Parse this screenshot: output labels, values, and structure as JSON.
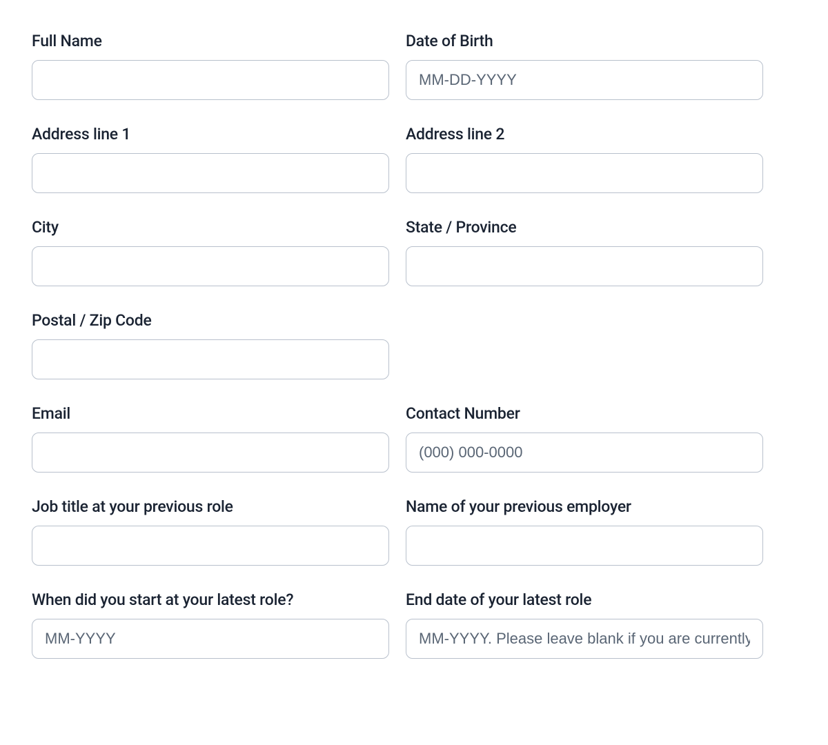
{
  "fields": {
    "full_name": {
      "label": "Full Name",
      "placeholder": "",
      "value": ""
    },
    "dob": {
      "label": "Date of Birth",
      "placeholder": "MM-DD-YYYY",
      "value": ""
    },
    "address1": {
      "label": "Address line 1",
      "placeholder": "",
      "value": ""
    },
    "address2": {
      "label": "Address line 2",
      "placeholder": "",
      "value": ""
    },
    "city": {
      "label": "City",
      "placeholder": "",
      "value": ""
    },
    "state": {
      "label": "State / Province",
      "placeholder": "",
      "value": ""
    },
    "postal": {
      "label": "Postal / Zip Code",
      "placeholder": "",
      "value": ""
    },
    "email": {
      "label": "Email",
      "placeholder": "",
      "value": ""
    },
    "contact": {
      "label": "Contact Number",
      "placeholder": "(000) 000-0000",
      "value": ""
    },
    "job_title": {
      "label": "Job title at your previous role",
      "placeholder": "",
      "value": ""
    },
    "employer": {
      "label": "Name of your previous employer",
      "placeholder": "",
      "value": ""
    },
    "start_date": {
      "label": "When did you start at your latest role?",
      "placeholder": "MM-YYYY",
      "value": ""
    },
    "end_date": {
      "label": "End date of your latest role",
      "placeholder": "MM-YYYY. Please leave blank if you are currently employed",
      "value": ""
    }
  }
}
